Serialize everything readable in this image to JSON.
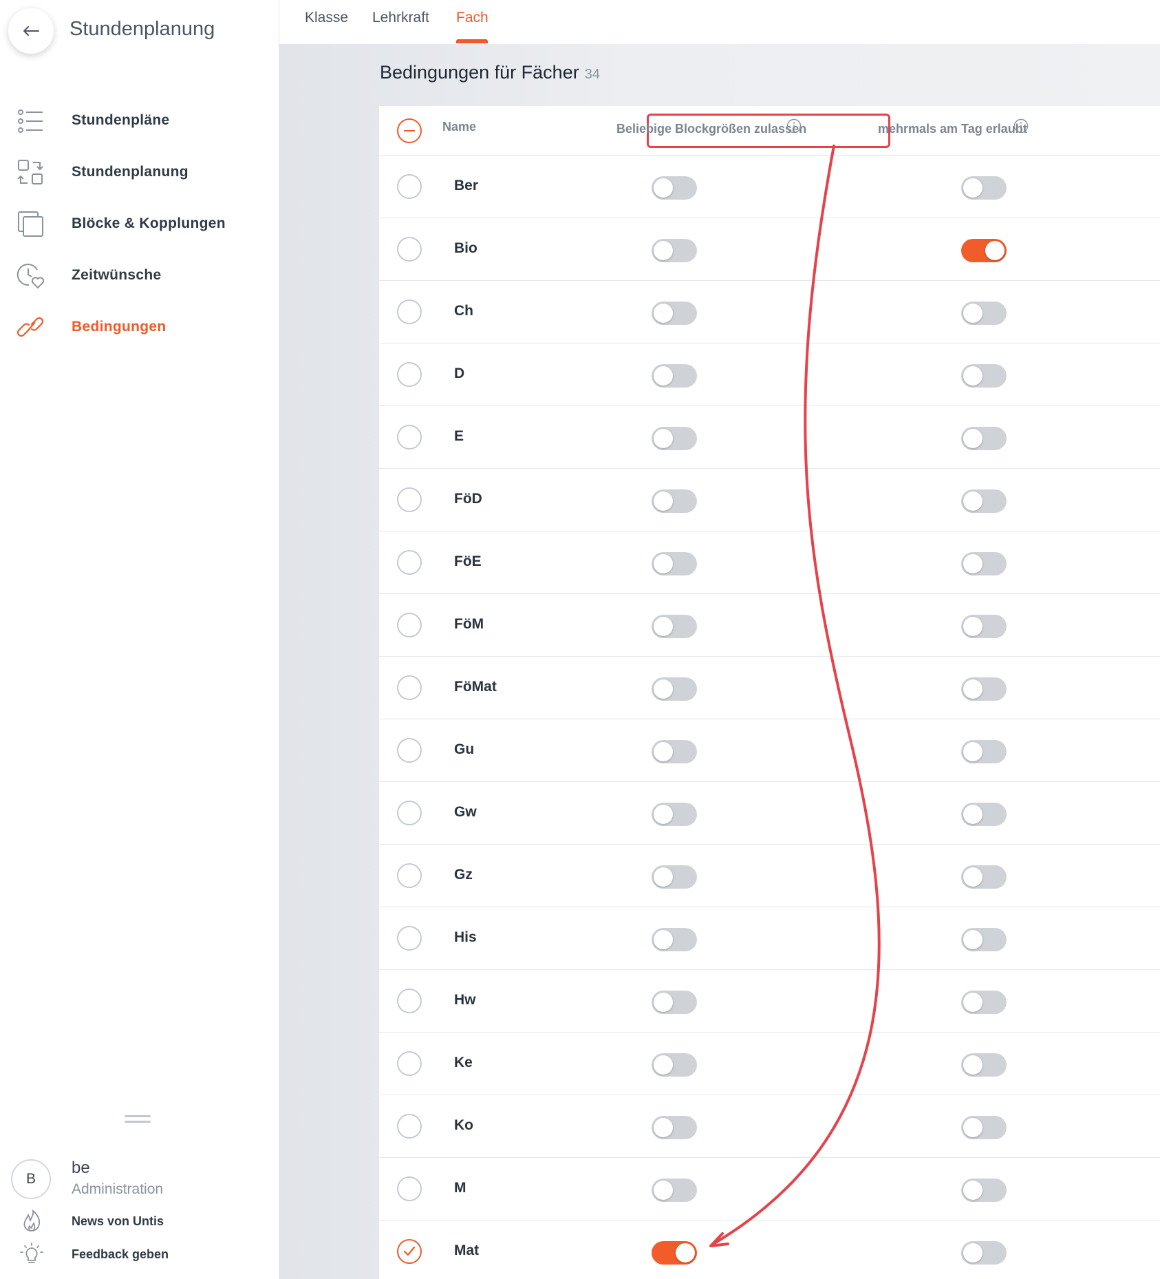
{
  "app": {
    "title": "Stundenplanung"
  },
  "sidebar": {
    "items": [
      {
        "label": "Stundenpläne",
        "icon": "list-icon",
        "active": false
      },
      {
        "label": "Stundenplanung",
        "icon": "swap-blocks-icon",
        "active": false
      },
      {
        "label": "Blöcke & Kopplungen",
        "icon": "copy-icon",
        "active": false
      },
      {
        "label": "Zeitwünsche",
        "icon": "clock-heart-icon",
        "active": false
      },
      {
        "label": "Bedingungen",
        "icon": "link-icon",
        "active": true
      }
    ],
    "user": {
      "initial": "B",
      "name": "be",
      "role": "Administration"
    },
    "footer": [
      {
        "label": "News von Untis",
        "icon": "flame-icon"
      },
      {
        "label": "Feedback geben",
        "icon": "lightbulb-icon"
      }
    ]
  },
  "tabs": [
    {
      "label": "Klasse",
      "active": false
    },
    {
      "label": "Lehrkraft",
      "active": false
    },
    {
      "label": "Fach",
      "active": true
    }
  ],
  "page": {
    "title": "Bedingungen für Fächer",
    "count": "34"
  },
  "table": {
    "headers": {
      "name": "Name",
      "col1": "Beliebige Blockgrößen zulassen",
      "col2": "mehrmals am Tag erlaubt"
    },
    "rows": [
      {
        "name": "Ber",
        "selected": false,
        "col1": false,
        "col2": false
      },
      {
        "name": "Bio",
        "selected": false,
        "col1": false,
        "col2": true
      },
      {
        "name": "Ch",
        "selected": false,
        "col1": false,
        "col2": false
      },
      {
        "name": "D",
        "selected": false,
        "col1": false,
        "col2": false
      },
      {
        "name": "E",
        "selected": false,
        "col1": false,
        "col2": false
      },
      {
        "name": "FöD",
        "selected": false,
        "col1": false,
        "col2": false
      },
      {
        "name": "FöE",
        "selected": false,
        "col1": false,
        "col2": false
      },
      {
        "name": "FöM",
        "selected": false,
        "col1": false,
        "col2": false
      },
      {
        "name": "FöMat",
        "selected": false,
        "col1": false,
        "col2": false
      },
      {
        "name": "Gu",
        "selected": false,
        "col1": false,
        "col2": false
      },
      {
        "name": "Gw",
        "selected": false,
        "col1": false,
        "col2": false
      },
      {
        "name": "Gz",
        "selected": false,
        "col1": false,
        "col2": false
      },
      {
        "name": "His",
        "selected": false,
        "col1": false,
        "col2": false
      },
      {
        "name": "Hw",
        "selected": false,
        "col1": false,
        "col2": false
      },
      {
        "name": "Ke",
        "selected": false,
        "col1": false,
        "col2": false
      },
      {
        "name": "Ko",
        "selected": false,
        "col1": false,
        "col2": false
      },
      {
        "name": "M",
        "selected": false,
        "col1": false,
        "col2": false
      },
      {
        "name": "Mat",
        "selected": true,
        "col1": true,
        "col2": false
      }
    ]
  },
  "colors": {
    "accent": "#f05a28",
    "annotation": "#e5424a"
  }
}
